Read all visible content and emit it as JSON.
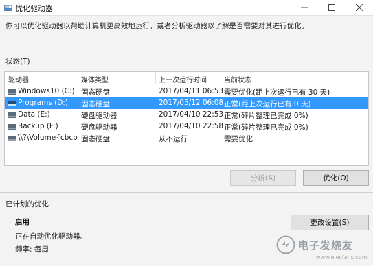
{
  "window": {
    "title": "优化驱动器",
    "icon": "defrag-icon",
    "controls": [
      "minimize-icon",
      "maximize-icon",
      "close-icon"
    ]
  },
  "description": "你可以优化驱动器以帮助计算机更高效地运行，或者分析驱动器以了解是否需要对其进行优化。",
  "status_label": "状态(T)",
  "columns": [
    "驱动器",
    "媒体类型",
    "上一次运行时间",
    "当前状态"
  ],
  "drives": [
    {
      "name": "Windows10 (C:)",
      "media": "固态硬盘",
      "last_run": "2017/04/11 06:53",
      "status": "需要优化(距上次运行已有 30 天)",
      "selected": false
    },
    {
      "name": "Programs (D:)",
      "media": "固态硬盘",
      "last_run": "2017/05/12 06:08",
      "status": "正常(距上次运行已有 0 天)",
      "selected": true
    },
    {
      "name": "Data (E:)",
      "media": "硬盘驱动器",
      "last_run": "2017/04/10 22:53",
      "status": "正常(碎片整理已完成 0%)",
      "selected": false
    },
    {
      "name": "Backup (F:)",
      "media": "硬盘驱动器",
      "last_run": "2017/04/10 22:58",
      "status": "正常(碎片整理已完成 0%)",
      "selected": false
    },
    {
      "name": "\\\\?\\Volume{cbcb...",
      "media": "固态硬盘",
      "last_run": "从不运行",
      "status": "需要优化",
      "selected": false
    }
  ],
  "buttons": {
    "analyze": "分析(A)",
    "optimize": "优化(O)",
    "change_settings": "更改设置(S)"
  },
  "scheduled": {
    "title": "已计划的优化",
    "state": "启用",
    "running": "正在自动优化驱动器。",
    "frequency": "频率: 每周"
  },
  "watermark": {
    "text": "电子发烧友",
    "url": "www.elecfans.com"
  },
  "colors": {
    "selection": "#3399ff",
    "window_bg": "#f3f3f3"
  }
}
